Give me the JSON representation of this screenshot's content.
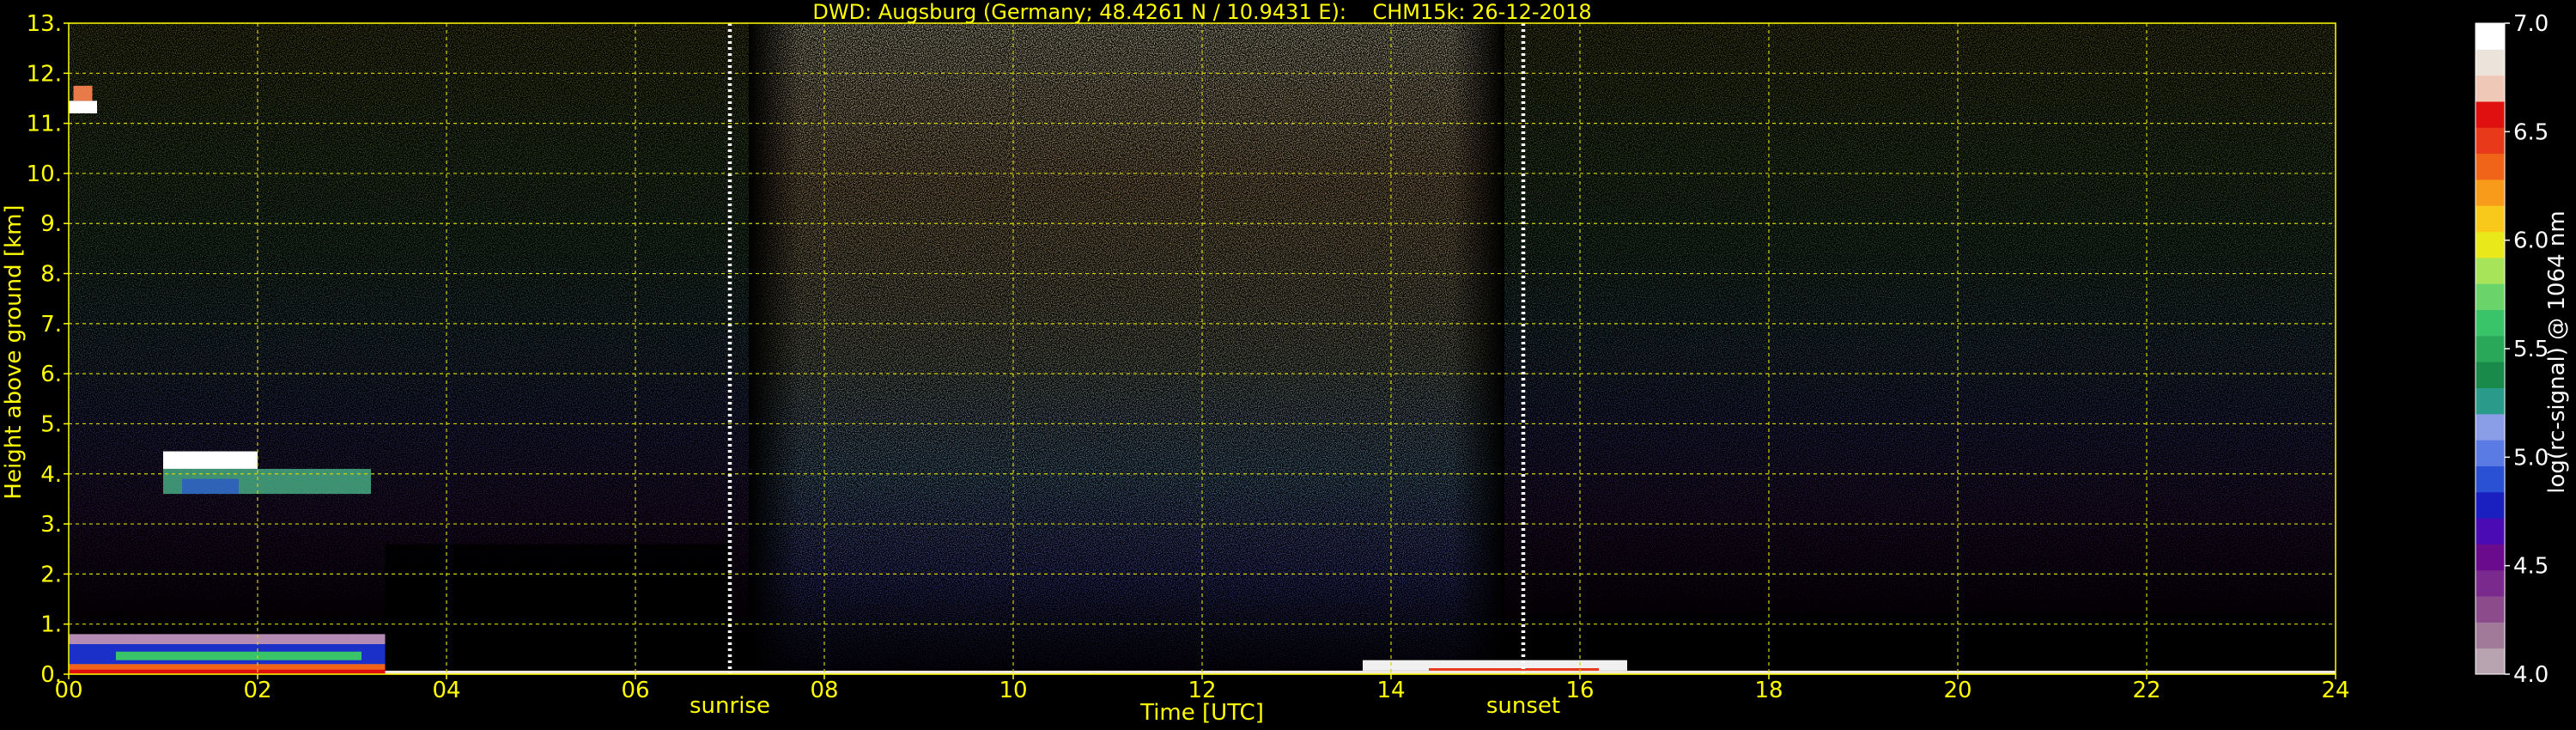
{
  "chart_data": {
    "type": "heatmap",
    "title": "DWD: Augsburg (Germany; 48.4261 N / 10.9431 E):    CHM15k: 26-12-2018",
    "xlabel": "Time [UTC]",
    "ylabel": "Height above ground [km]",
    "xlim": [
      0,
      24
    ],
    "ylim": [
      0,
      13
    ],
    "x_ticks": [
      0,
      2,
      4,
      6,
      8,
      10,
      12,
      14,
      16,
      18,
      20,
      22,
      24
    ],
    "x_tick_labels": [
      "00",
      "02",
      "04",
      "06",
      "08",
      "10",
      "12",
      "14",
      "16",
      "18",
      "20",
      "22",
      "24"
    ],
    "y_ticks": [
      0,
      1,
      2,
      3,
      4,
      5,
      6,
      7,
      8,
      9,
      10,
      11,
      12,
      13
    ],
    "y_tick_labels": [
      "0.",
      "1.",
      "2.",
      "3.",
      "4.",
      "5.",
      "6.",
      "7.",
      "8.",
      "9.",
      "10.",
      "11.",
      "12.",
      "13."
    ],
    "grid": true,
    "markers": [
      {
        "label": "sunrise",
        "time": 7.0
      },
      {
        "label": "sunset",
        "time": 15.4
      }
    ],
    "colorbar": {
      "label": "log(rc-signal) @ 1064 nm",
      "range": [
        4.0,
        7.0
      ],
      "tick_values": [
        4.0,
        4.5,
        5.0,
        5.5,
        6.0,
        6.5,
        7.0
      ],
      "tick_labels": [
        "4.0",
        "4.5",
        "5.0",
        "5.5",
        "6.0",
        "6.5",
        "7.0"
      ],
      "colors": [
        "#b8a4b0",
        "#a07a98",
        "#8c4c8c",
        "#7a2a8c",
        "#6a0a8c",
        "#4a0ab4",
        "#1a20c0",
        "#2a50d4",
        "#5a7ae4",
        "#8a9ee8",
        "#2a9a8a",
        "#1a8a4a",
        "#2aa85a",
        "#3ac46a",
        "#6ad46a",
        "#a8e45a",
        "#e8e81a",
        "#f8c81a",
        "#f89a1a",
        "#f0641a",
        "#e83a1a",
        "#e01010",
        "#f0c8b8",
        "#ece4da",
        "#ffffff"
      ]
    }
  }
}
